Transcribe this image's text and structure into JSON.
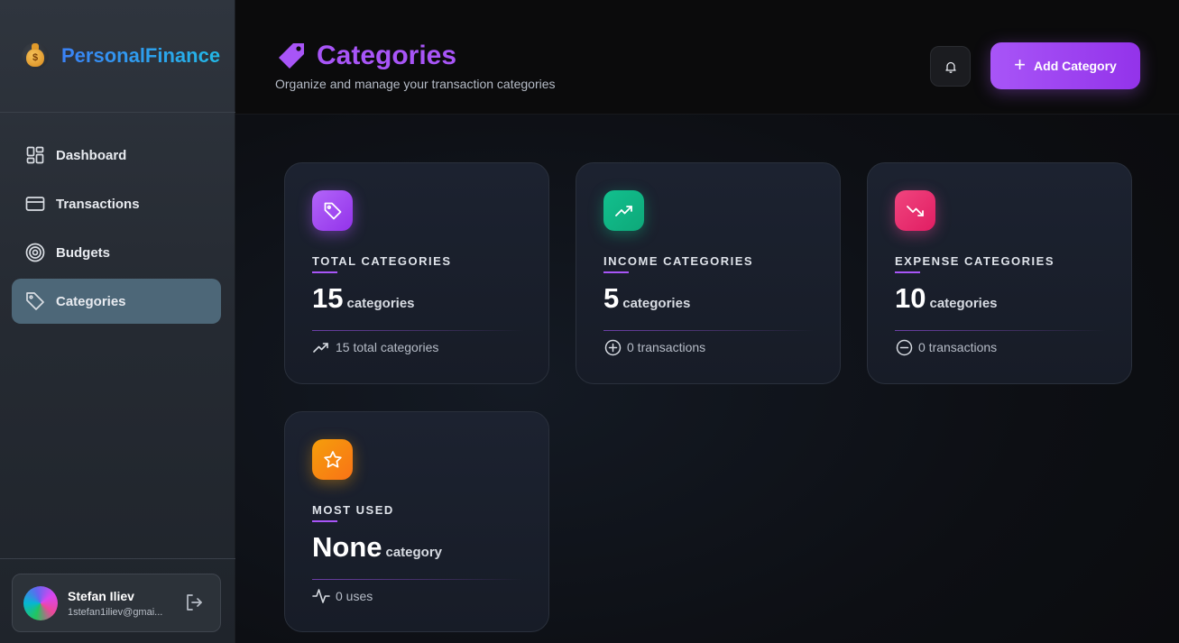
{
  "brand": {
    "name": "PersonalFinance",
    "icon_glyph": "$"
  },
  "nav": [
    {
      "label": "Dashboard",
      "icon": "dashboard-icon"
    },
    {
      "label": "Transactions",
      "icon": "card-icon"
    },
    {
      "label": "Budgets",
      "icon": "target-icon"
    },
    {
      "label": "Categories",
      "icon": "tag-icon",
      "active": true
    }
  ],
  "user": {
    "name": "Stefan Iliev",
    "email": "1stefan1iliev@gmai..."
  },
  "header": {
    "title": "Categories",
    "subtitle": "Organize and manage your transaction categories",
    "add_button": "Add Category",
    "add_button_glyph": "+"
  },
  "cards": [
    {
      "label": "TOTAL CATEGORIES",
      "value": "15",
      "unit": "categories",
      "footer": "15 total categories",
      "icon": "tag-icon",
      "color": "#a855f7"
    },
    {
      "label": "INCOME CATEGORIES",
      "value": "5",
      "unit": "categories",
      "footer": "0 transactions",
      "icon": "trending-up-icon",
      "color": "#10b981"
    },
    {
      "label": "EXPENSE CATEGORIES",
      "value": "10",
      "unit": "categories",
      "footer": "0 transactions",
      "icon": "trending-down-icon",
      "color": "#ec4899"
    },
    {
      "label": "MOST USED",
      "value": "None",
      "unit": "category",
      "footer": "0 uses",
      "icon": "star-icon",
      "color": "#f59e0b"
    }
  ],
  "colors": {
    "accent": "#a855f7",
    "brand": "#3b82f6",
    "active_nav": "#4d6778"
  }
}
